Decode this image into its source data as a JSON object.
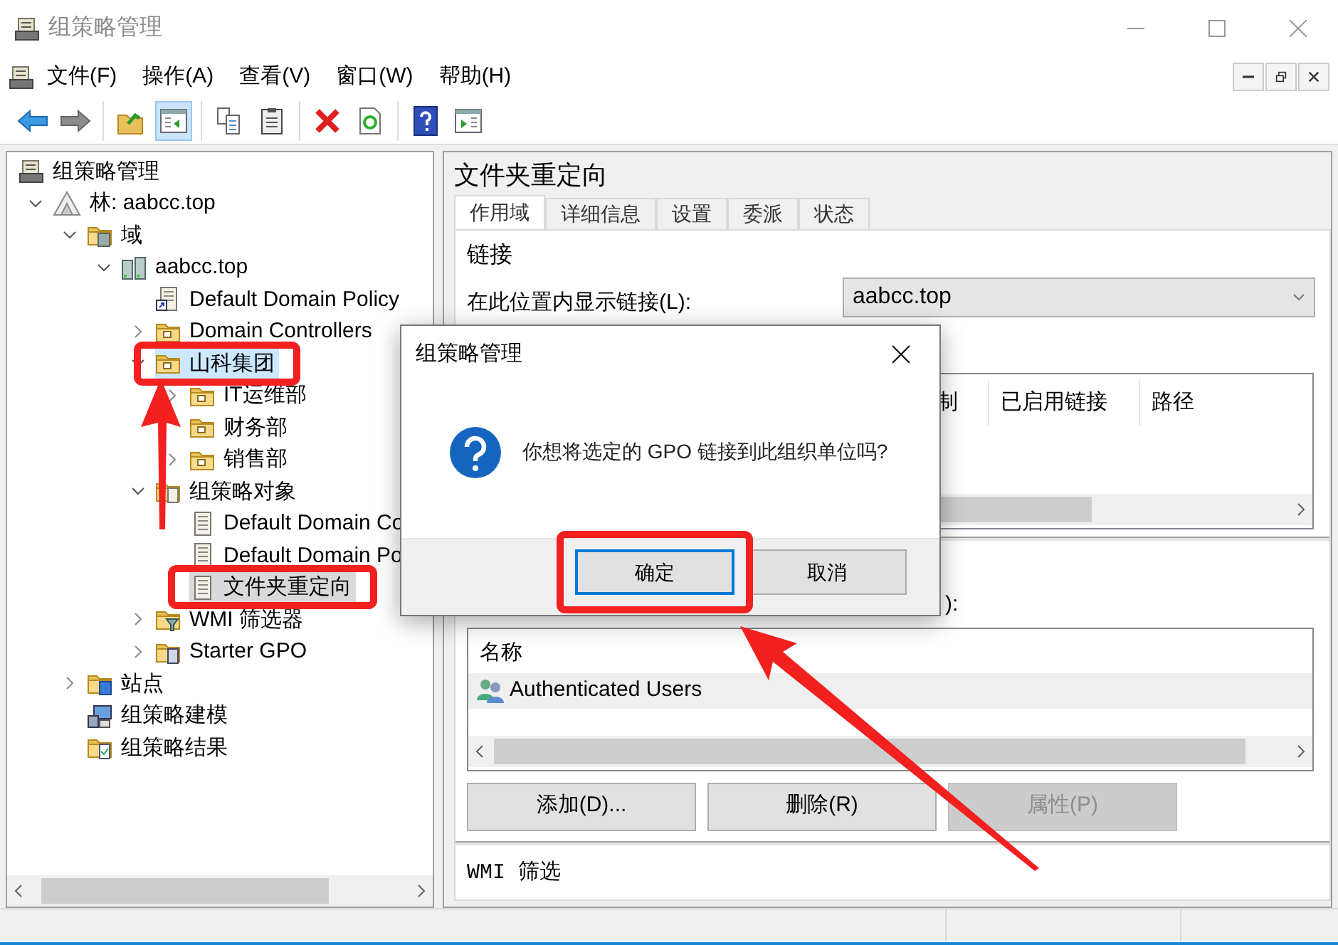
{
  "window": {
    "title": "组策略管理"
  },
  "menu": [
    "文件(F)",
    "操作(A)",
    "查看(V)",
    "窗口(W)",
    "帮助(H)"
  ],
  "toolbar": [
    [
      {
        "kind": "back",
        "on": false
      },
      {
        "kind": "forward",
        "on": false
      }
    ],
    [
      {
        "kind": "up",
        "on": false
      },
      {
        "kind": "pane",
        "on": true
      }
    ],
    [
      {
        "kind": "copy",
        "on": false
      },
      {
        "kind": "paste",
        "on": false
      }
    ],
    [
      {
        "kind": "delete",
        "on": false
      },
      {
        "kind": "refresh",
        "on": false
      }
    ],
    [
      {
        "kind": "help",
        "on": false
      },
      {
        "kind": "pane2",
        "on": false
      }
    ]
  ],
  "tree": {
    "label": "组策略管理",
    "kind": "console",
    "selected": false,
    "hover": false,
    "annotated": false,
    "children": [
      {
        "label": "林: aabcc.top",
        "kind": "forest",
        "expanded": true,
        "selected": false,
        "hover": false,
        "annotated": false,
        "children": [
          {
            "label": "域",
            "kind": "domains",
            "expanded": true,
            "selected": false,
            "hover": false,
            "annotated": false,
            "children": [
              {
                "label": "aabcc.top",
                "kind": "domain",
                "expanded": true,
                "selected": false,
                "hover": false,
                "annotated": false,
                "children": [
                  {
                    "label": "Default Domain Policy",
                    "kind": "gpo-link",
                    "selected": false,
                    "hover": false,
                    "annotated": false
                  },
                  {
                    "label": "Domain Controllers",
                    "kind": "ou",
                    "expanded": false,
                    "selected": false,
                    "hover": false,
                    "annotated": false
                  },
                  {
                    "label": "山科集团",
                    "kind": "ou",
                    "expanded": true,
                    "selected": false,
                    "hover": true,
                    "annotated": true,
                    "children": [
                      {
                        "label": "IT运维部",
                        "kind": "ou",
                        "expanded": false,
                        "selected": false,
                        "hover": false,
                        "annotated": false
                      },
                      {
                        "label": "财务部",
                        "kind": "ou",
                        "selected": false,
                        "hover": false,
                        "annotated": false
                      },
                      {
                        "label": "销售部",
                        "kind": "ou",
                        "expanded": false,
                        "selected": false,
                        "hover": false,
                        "annotated": false
                      }
                    ]
                  },
                  {
                    "label": "组策略对象",
                    "kind": "gpo-folder",
                    "expanded": true,
                    "selected": false,
                    "hover": false,
                    "annotated": false,
                    "children": [
                      {
                        "label": "Default Domain Co",
                        "kind": "gpo",
                        "selected": false,
                        "hover": false,
                        "annotated": false
                      },
                      {
                        "label": "Default Domain Po",
                        "kind": "gpo",
                        "selected": false,
                        "hover": false,
                        "annotated": false
                      },
                      {
                        "label": "文件夹重定向",
                        "kind": "gpo",
                        "selected": true,
                        "hover": false,
                        "annotated": true
                      }
                    ]
                  },
                  {
                    "label": "WMI 筛选器",
                    "kind": "wmi",
                    "expanded": false,
                    "selected": false,
                    "hover": false,
                    "annotated": false
                  },
                  {
                    "label": "Starter GPO",
                    "kind": "starter",
                    "expanded": false,
                    "selected": false,
                    "hover": false,
                    "annotated": false
                  }
                ]
              }
            ]
          },
          {
            "label": "站点",
            "kind": "sites",
            "expanded": false,
            "selected": false,
            "hover": false,
            "annotated": false
          },
          {
            "label": "组策略建模",
            "kind": "modeling",
            "selected": false,
            "hover": false,
            "annotated": false
          },
          {
            "label": "组策略结果",
            "kind": "results",
            "selected": false,
            "hover": false,
            "annotated": false
          }
        ]
      }
    ]
  },
  "details": {
    "title": "文件夹重定向",
    "tabs": [
      {
        "label": "作用域",
        "selected": true
      },
      {
        "label": "详细信息",
        "selected": false
      },
      {
        "label": "设置",
        "selected": false
      },
      {
        "label": "委派",
        "selected": false
      },
      {
        "label": "状态",
        "selected": false
      }
    ],
    "links": {
      "heading": "链接",
      "location_label": "在此位置内显示链接(L):",
      "location_value": "aabcc.top",
      "columns": [
        "制",
        "已启用链接",
        "路径"
      ]
    },
    "security_filtering": {
      "label": "):",
      "column": "名称",
      "rows": [
        {
          "name": "Authenticated Users",
          "selected": true
        }
      ],
      "buttons": [
        {
          "label": "添加(D)...",
          "disabled": false
        },
        {
          "label": "删除(R)",
          "disabled": false
        },
        {
          "label": "属性(P)",
          "disabled": true
        }
      ]
    },
    "wmi_heading": "WMI 筛选"
  },
  "dialog": {
    "title": "组策略管理",
    "message": "你想将选定的 GPO 链接到此组织单位吗?",
    "buttons": [
      {
        "label": "确定",
        "default": true,
        "annotated": true
      },
      {
        "label": "取消",
        "default": false,
        "annotated": false
      }
    ]
  }
}
